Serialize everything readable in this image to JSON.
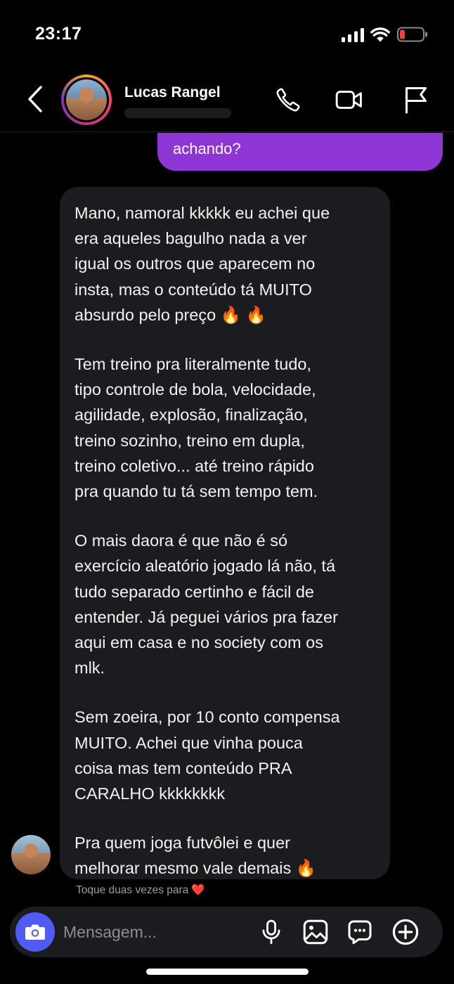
{
  "status_bar": {
    "time": "23:17",
    "battery_color": "#ff3b30"
  },
  "header": {
    "contact_name": "Lucas Rangel",
    "icons": [
      "back-chevron-icon",
      "phone-icon",
      "video-camera-icon",
      "flag-icon"
    ]
  },
  "messages": {
    "sent_partial": "achando?",
    "received_paragraphs": [
      "Mano, namoral kkkkk eu achei que\nera aqueles bagulho nada a ver\nigual os outros que aparecem no\ninsta, mas o conteúdo tá MUITO\nabsurdo pelo preço 🔥 🔥",
      "Tem treino pra literalmente tudo,\ntipo controle de bola, velocidade,\nagilidade, explosão, finalização,\ntreino sozinho, treino em dupla,\ntreino coletivo... até treino rápido\npra quando tu tá sem tempo tem.",
      "O mais daora é que não é só\nexercício aleatório jogado lá não, tá\ntudo separado certinho e fácil de\nentender. Já peguei vários pra fazer\naqui em casa e no society com os\nmlk.",
      "Sem zoeira, por 10 conto compensa\nMUITO. Achei que vinha pouca\ncoisa mas tem conteúdo PRA\nCARALHO kkkkkkkk",
      "Pra quem joga futvôlei e quer\nmelhorar mesmo vale demais 🔥"
    ],
    "double_tap_hint": "Toque duas vezes para",
    "hint_heart": "❤️"
  },
  "composer": {
    "placeholder": "Mensagem...",
    "icons": [
      "camera-icon",
      "microphone-icon",
      "gallery-icon",
      "sticker-icon",
      "plus-icon"
    ]
  },
  "colors": {
    "sent_bubble": "#8e35d6",
    "received_bubble": "#1b1c1f",
    "camera_button": "#4f5bf2",
    "background": "#000000"
  }
}
